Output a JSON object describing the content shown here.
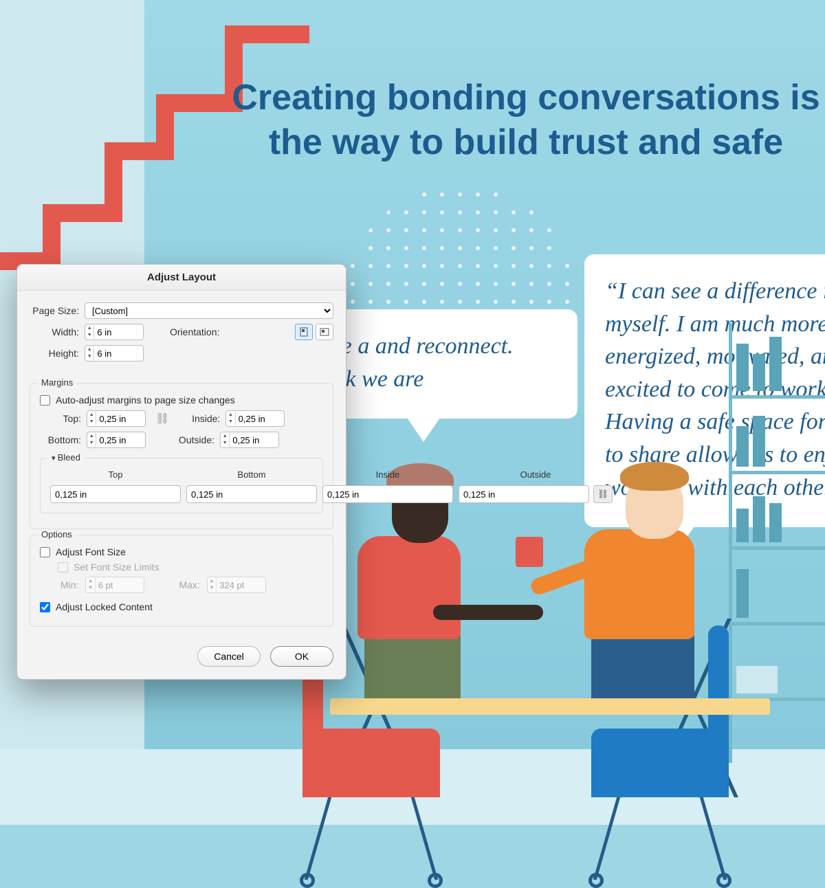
{
  "artwork": {
    "headline": "Creating bonding conversations is the way to build trust and safe",
    "quote_left": "that we have a and reconnect. appy at work we are",
    "quote_right": "“I can see a difference in myself. I am much more energized, motivated, an excited to come to work. Having a safe space for u to share allows us to enjo working with each other"
  },
  "dialog": {
    "title": "Adjust Layout",
    "page_size_label": "Page Size:",
    "page_size_value": "[Custom]",
    "width_label": "Width:",
    "width_value": "6 in",
    "height_label": "Height:",
    "height_value": "6 in",
    "orientation_label": "Orientation:",
    "margins": {
      "legend": "Margins",
      "auto_label": "Auto-adjust margins to page size changes",
      "auto_checked": false,
      "top_label": "Top:",
      "top_value": "0,25 in",
      "bottom_label": "Bottom:",
      "bottom_value": "0,25 in",
      "inside_label": "Inside:",
      "inside_value": "0,25 in",
      "outside_label": "Outside:",
      "outside_value": "0,25 in"
    },
    "bleed": {
      "legend": "Bleed",
      "headers": {
        "top": "Top",
        "bottom": "Bottom",
        "inside": "Inside",
        "outside": "Outside"
      },
      "top": "0,125 in",
      "bottom": "0,125 in",
      "inside": "0,125 in",
      "outside": "0,125 in"
    },
    "options": {
      "legend": "Options",
      "adjust_font_label": "Adjust Font Size",
      "adjust_font_checked": false,
      "set_limits_label": "Set Font Size Limits",
      "min_label": "Min:",
      "min_value": "6 pt",
      "max_label": "Max:",
      "max_value": "324 pt",
      "adjust_locked_label": "Adjust Locked Content",
      "adjust_locked_checked": true
    },
    "buttons": {
      "cancel": "Cancel",
      "ok": "OK"
    }
  }
}
